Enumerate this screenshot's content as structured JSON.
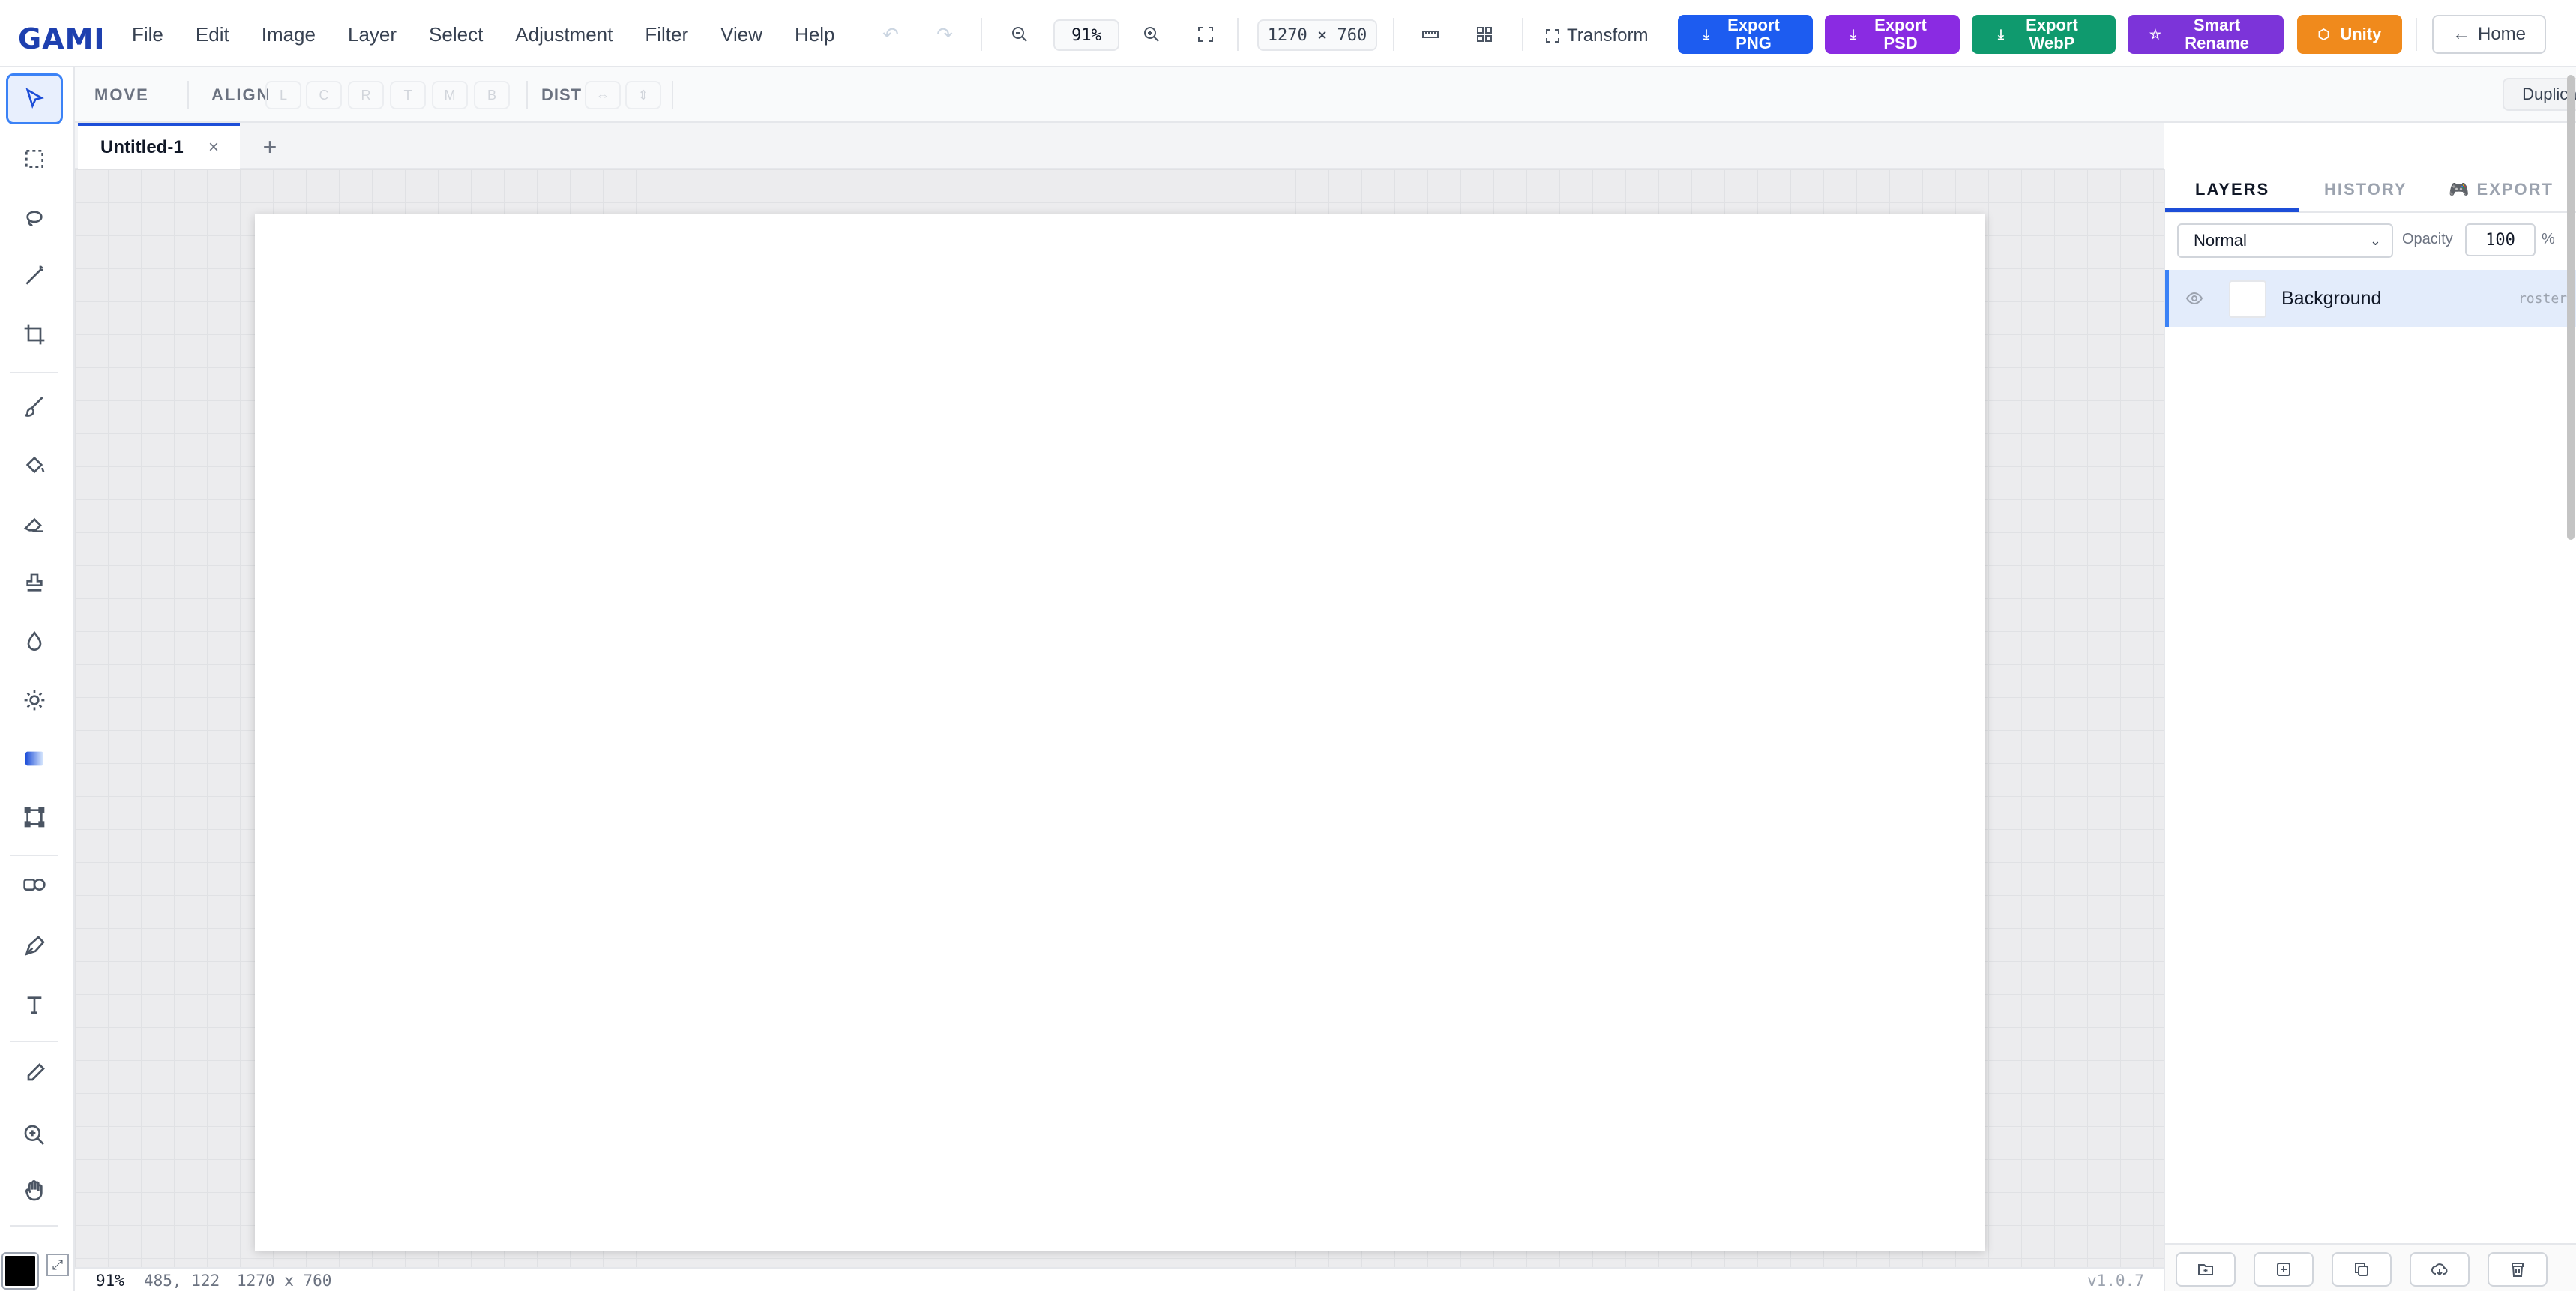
{
  "app": {
    "logo": "GAMI",
    "menu": [
      "File",
      "Edit",
      "Image",
      "Layer",
      "Select",
      "Adjustment",
      "Filter",
      "View",
      "Help"
    ]
  },
  "toolbar": {
    "zoom": "91%",
    "canvas_size": "1270 × 760",
    "transform_label": "Transform",
    "exports": [
      {
        "label": "Export PNG",
        "color": "#1d5cf0"
      },
      {
        "label": "Export PSD",
        "color": "#8a2be2"
      },
      {
        "label": "Export WebP",
        "color": "#0f9a6e"
      },
      {
        "label": "Smart Rename",
        "color": "#7c34d9"
      },
      {
        "label": "Unity",
        "color": "#f08a1c"
      }
    ],
    "home_label": "Home"
  },
  "options": {
    "tool_label": "MOVE",
    "align_label": "ALIGN",
    "align_buttons": [
      "L",
      "C",
      "R",
      "T",
      "M",
      "B"
    ],
    "dist_label": "DIST",
    "dist_buttons": [
      "⇔",
      "⇕"
    ],
    "duplicate_label": "Duplicate"
  },
  "tabs": {
    "active": "Untitled-1",
    "close": "×",
    "add": "+"
  },
  "tools": [
    "move",
    "marquee",
    "lasso",
    "magic-wand",
    "crop",
    "brush",
    "fill",
    "eraser",
    "stamp",
    "blur",
    "dodge",
    "gradient",
    "transform",
    "shape",
    "pen",
    "text",
    "eyedropper",
    "zoom",
    "hand"
  ],
  "colors": {
    "foreground": "#000000",
    "accent": "#1d4ed8"
  },
  "panel": {
    "tabs": [
      "LAYERS",
      "HISTORY",
      "EXPORT"
    ],
    "active_tab": "LAYERS",
    "blend_mode": "Normal",
    "opacity_label": "Opacity",
    "opacity_value": "100",
    "opacity_unit": "%",
    "layers": [
      {
        "name": "Background",
        "type": "roster"
      }
    ]
  },
  "status": {
    "zoom": "91%",
    "cursor": "485, 122",
    "size": "1270 x 760",
    "version": "v1.0.7"
  }
}
